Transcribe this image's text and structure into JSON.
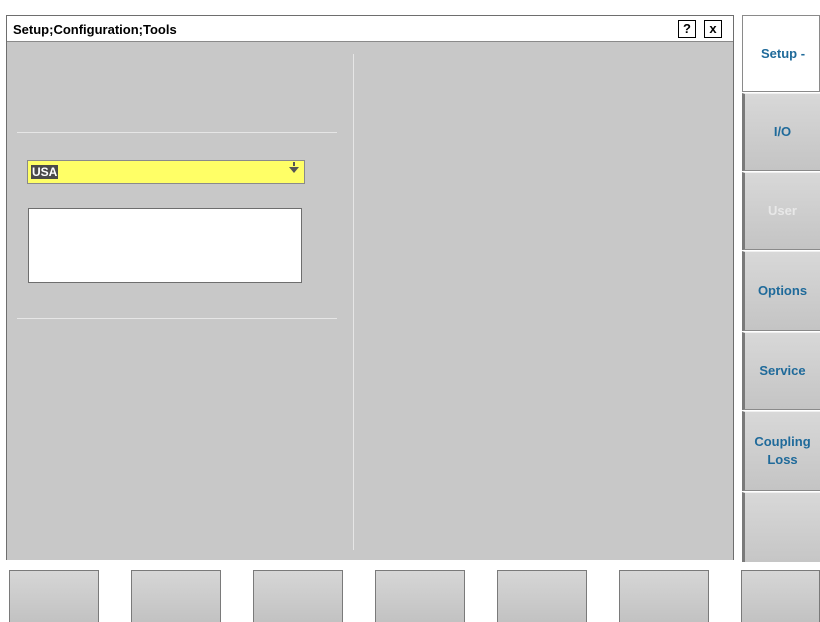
{
  "dialog": {
    "title": "Setup;Configuration;Tools",
    "help_label": "?",
    "close_label": "x",
    "country_select": {
      "selected": "USA"
    },
    "text_box": {
      "value": ""
    }
  },
  "softkeys_right": [
    {
      "label": "Setup -",
      "state": "active"
    },
    {
      "label": "I/O",
      "state": "normal"
    },
    {
      "label": "User",
      "state": "disabled"
    },
    {
      "label": "Options",
      "state": "normal"
    },
    {
      "label": "Service",
      "state": "normal"
    },
    {
      "label": "Coupling\nLoss",
      "state": "normal"
    },
    {
      "label": "",
      "state": "normal"
    }
  ],
  "softkeys_bottom": [
    {
      "label": ""
    },
    {
      "label": ""
    },
    {
      "label": ""
    },
    {
      "label": ""
    },
    {
      "label": ""
    },
    {
      "label": ""
    },
    {
      "label": ""
    }
  ],
  "colors": {
    "panel_bg": "#c8c8c8",
    "select_bg": "#ffff66",
    "softkey_text": "#1f6a9a"
  }
}
